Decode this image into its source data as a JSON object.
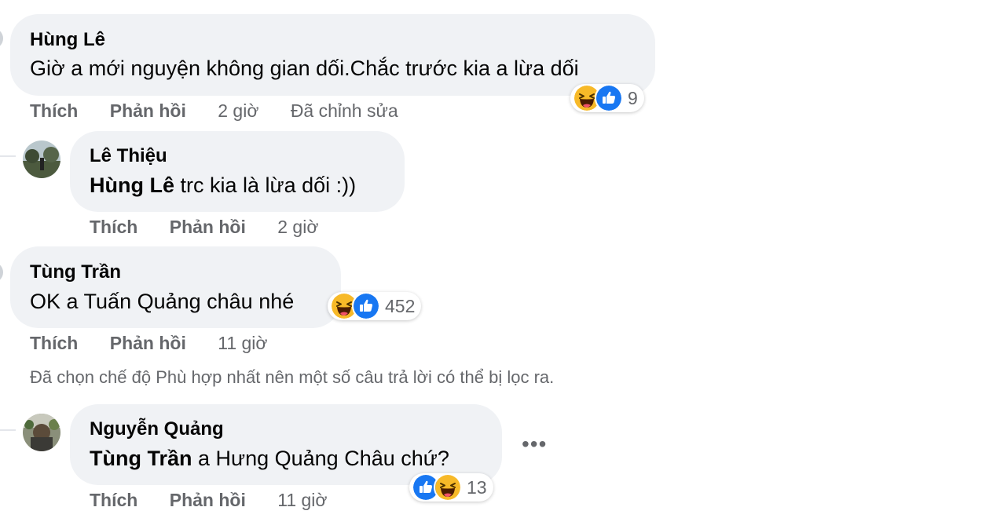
{
  "comments": [
    {
      "author": "Hùng Lê",
      "text": "Giờ a mới nguyện không gian dối.Chắc trước kia a lừa dối",
      "actions": {
        "like": "Thích",
        "reply": "Phản hồi",
        "time": "2 giờ",
        "edited": "Đã chỉnh sửa"
      },
      "reactions": {
        "icons": [
          "haha-icon",
          "like-icon"
        ],
        "count": "9"
      }
    },
    {
      "author": "Lê Thiệu",
      "mention": "Hùng Lê",
      "text": " trc kia là lừa dối :))",
      "actions": {
        "like": "Thích",
        "reply": "Phản hồi",
        "time": "2 giờ"
      }
    },
    {
      "author": "Tùng Trần",
      "text": "OK a Tuấn Quảng châu nhé",
      "actions": {
        "like": "Thích",
        "reply": "Phản hồi",
        "time": "11 giờ"
      },
      "reactions": {
        "icons": [
          "haha-icon",
          "like-icon"
        ],
        "count": "452"
      }
    },
    {
      "author": "Nguyễn Quảng",
      "mention": "Tùng Trần",
      "text": " a Hưng Quảng Châu chứ?",
      "actions": {
        "like": "Thích",
        "reply": "Phản hồi",
        "time": "11 giờ"
      },
      "reactions": {
        "icons": [
          "like-icon",
          "haha-icon"
        ],
        "count": "13"
      },
      "more": "•••"
    }
  ],
  "filter_note": "Đã chọn chế độ Phù hợp nhất nên một số câu trả lời có thể bị lọc ra.",
  "colors": {
    "bubble": "#f0f2f5",
    "like_blue": "#1877f2",
    "haha_yellow": "#f7b928",
    "secondary_text": "#65676b"
  }
}
